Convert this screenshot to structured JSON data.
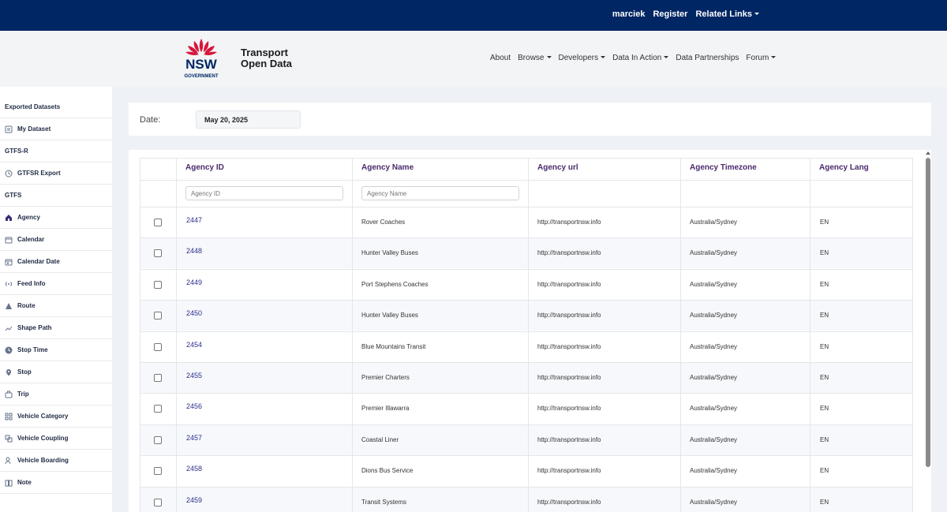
{
  "topbar": {
    "user": "marciek",
    "register": "Register",
    "related_links": "Related Links"
  },
  "brand": {
    "logo_text": "NSW",
    "logo_sub": "GOVERNMENT",
    "line1": "Transport",
    "line2": "Open Data",
    "logo_red": "#d7153a",
    "logo_blue": "#002664"
  },
  "nav": [
    {
      "label": "About",
      "caret": false
    },
    {
      "label": "Browse",
      "caret": true
    },
    {
      "label": "Developers",
      "caret": true
    },
    {
      "label": "Data In Action",
      "caret": true
    },
    {
      "label": "Data Partnerships",
      "caret": false
    },
    {
      "label": "Forum",
      "caret": true
    }
  ],
  "sidebar": [
    {
      "label": "Exported Datasets",
      "section": true,
      "icon": ""
    },
    {
      "label": "My Dataset",
      "section": false,
      "icon": "dataset-icon"
    },
    {
      "label": "GTFS-R",
      "section": true,
      "icon": ""
    },
    {
      "label": "GTFSR Export",
      "section": false,
      "icon": "clock-icon"
    },
    {
      "label": "GTFS",
      "section": true,
      "icon": ""
    },
    {
      "label": "Agency",
      "section": false,
      "icon": "home-icon",
      "active": true
    },
    {
      "label": "Calendar",
      "section": false,
      "icon": "calendar-icon"
    },
    {
      "label": "Calendar Date",
      "section": false,
      "icon": "calendar-date-icon"
    },
    {
      "label": "Feed Info",
      "section": false,
      "icon": "broadcast-icon"
    },
    {
      "label": "Route",
      "section": false,
      "icon": "route-icon"
    },
    {
      "label": "Shape Path",
      "section": false,
      "icon": "shape-path-icon"
    },
    {
      "label": "Stop Time",
      "section": false,
      "icon": "stop-time-icon"
    },
    {
      "label": "Stop",
      "section": false,
      "icon": "map-pin-icon"
    },
    {
      "label": "Trip",
      "section": false,
      "icon": "suitcase-icon"
    },
    {
      "label": "Vehicle Category",
      "section": false,
      "icon": "grid-icon"
    },
    {
      "label": "Vehicle Coupling",
      "section": false,
      "icon": "coupling-icon"
    },
    {
      "label": "Vehicle Boarding",
      "section": false,
      "icon": "person-icon"
    },
    {
      "label": "Note",
      "section": false,
      "icon": "book-icon"
    }
  ],
  "date": {
    "label": "Date:",
    "value": "May 20, 2025"
  },
  "table": {
    "headers": [
      "Agency ID",
      "Agency Name",
      "Agency url",
      "Agency Timezone",
      "Agency Lang"
    ],
    "filters": {
      "id_placeholder": "Agency ID",
      "name_placeholder": "Agency Name"
    },
    "rows": [
      [
        "2447",
        "Rover Coaches",
        "http://transportnsw.info",
        "Australia/Sydney",
        "EN"
      ],
      [
        "2448",
        "Hunter Valley Buses",
        "http://transportnsw.info",
        "Australia/Sydney",
        "EN"
      ],
      [
        "2449",
        "Port Stephens Coaches",
        "http://transportnsw.info",
        "Australia/Sydney",
        "EN"
      ],
      [
        "2450",
        "Hunter Valley Buses",
        "http://transportnsw.info",
        "Australia/Sydney",
        "EN"
      ],
      [
        "2454",
        "Blue Mountains Transit",
        "http://transportnsw.info",
        "Australia/Sydney",
        "EN"
      ],
      [
        "2455",
        "Premier Charters",
        "http://transportnsw.info",
        "Australia/Sydney",
        "EN"
      ],
      [
        "2456",
        "Premier Illawarra",
        "http://transportnsw.info",
        "Australia/Sydney",
        "EN"
      ],
      [
        "2457",
        "Coastal Liner",
        "http://transportnsw.info",
        "Australia/Sydney",
        "EN"
      ],
      [
        "2458",
        "Dions Bus Service",
        "http://transportnsw.info",
        "Australia/Sydney",
        "EN"
      ],
      [
        "2459",
        "Transit Systems",
        "http://transportnsw.info",
        "Australia/Sydney",
        "EN"
      ]
    ]
  }
}
